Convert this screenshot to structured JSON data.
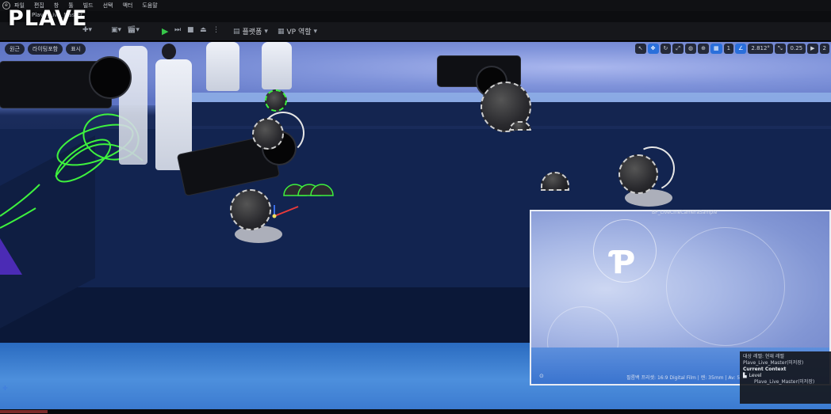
{
  "window": {
    "logo": "PLAVE",
    "level_tab": "Plave_Live_Master"
  },
  "menu": [
    "파일",
    "편집",
    "창",
    "툴",
    "빌드",
    "선택",
    "액터",
    "도움말"
  ],
  "toolbar": {
    "platforms_label": "플랫폼",
    "vp_label": "VP 역할"
  },
  "viewport": {
    "top_left_chips": [
      "원근",
      "라이팅포함",
      "표시"
    ],
    "top_right_controls": {
      "grid_value": "1",
      "angle_value": "2.812°",
      "scale_value": "0.25",
      "cam_speed": "2"
    },
    "cinecam_label": "BP_LiveCineCameraSample"
  },
  "preview": {
    "caption": "필름백 프리셋: 16:9 Digital Film | 렌: 35mm | Av: 5.6"
  },
  "context_panel": {
    "header_line": "대상 레벨: 현재 레벨",
    "level_name_top": "Plave_Live_Master(미저장)",
    "current_context": "Current Context",
    "level": "Level",
    "level_name": "Plave_Live_Master(미저장)"
  },
  "colors": {
    "play_green": "#37c64a",
    "active_blue": "#2a6fdb",
    "gizmo_green": "#3ef23e"
  }
}
